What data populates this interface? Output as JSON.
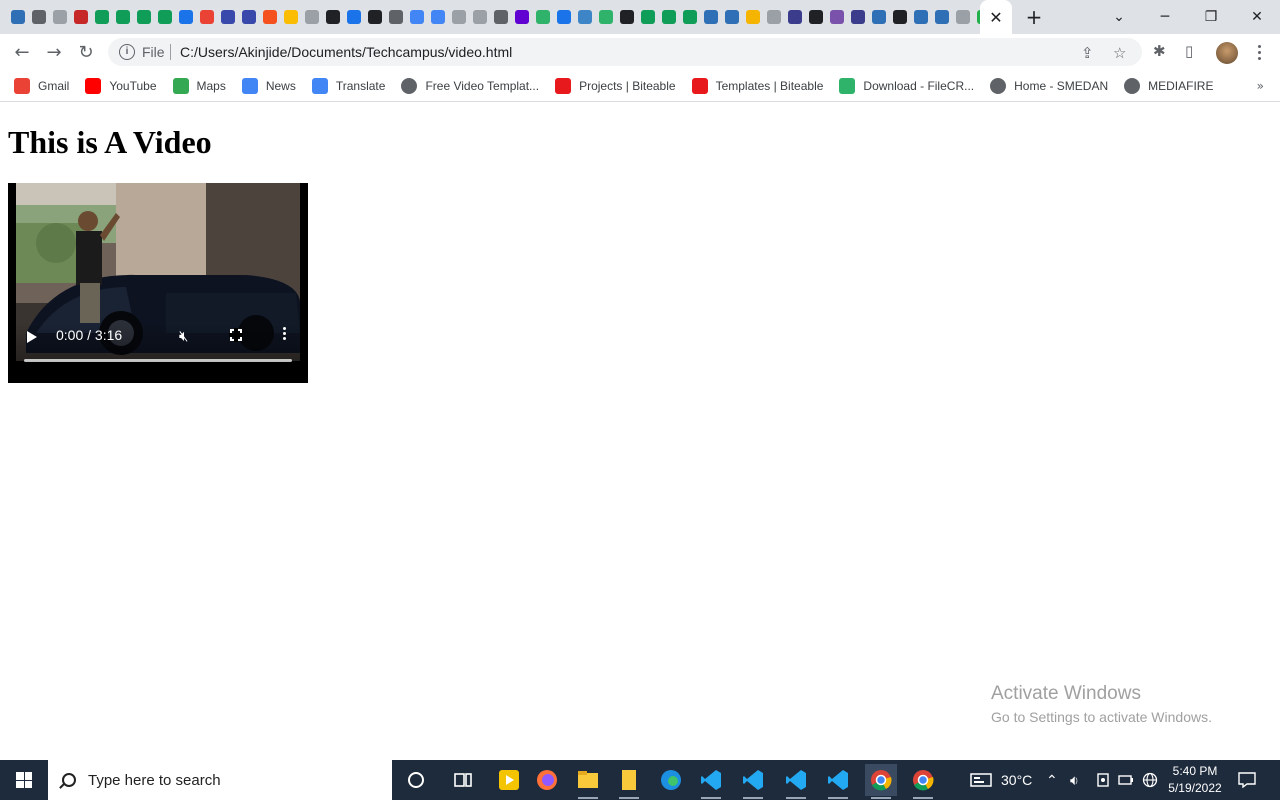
{
  "browser": {
    "url_scheme": "File",
    "url": "C:/Users/Akinjide/Documents/Techcampus/video.html",
    "active_tab_close": "✕",
    "new_tab": "+"
  },
  "bookmarks": [
    {
      "label": "Gmail",
      "icon": "gmail-icon",
      "color": "#ea4335"
    },
    {
      "label": "YouTube",
      "icon": "youtube-icon",
      "color": "#ff0000"
    },
    {
      "label": "Maps",
      "icon": "maps-pin-icon",
      "color": "#34a853"
    },
    {
      "label": "News",
      "icon": "news-icon",
      "color": "#4285f4"
    },
    {
      "label": "Translate",
      "icon": "translate-icon",
      "color": "#4285f4"
    },
    {
      "label": "Free Video Templat...",
      "icon": "globe-icon",
      "color": "#5f6368"
    },
    {
      "label": "Projects | Biteable",
      "icon": "biteable-icon",
      "color": "#e8191c"
    },
    {
      "label": "Templates | Biteable",
      "icon": "biteable-icon",
      "color": "#e8191c"
    },
    {
      "label": "Download - FileCR...",
      "icon": "filecr-icon",
      "color": "#2fb36a"
    },
    {
      "label": "Home - SMEDAN",
      "icon": "globe-icon",
      "color": "#5f6368"
    },
    {
      "label": "MEDIAFIRE",
      "icon": "globe-icon",
      "color": "#5f6368"
    }
  ],
  "page": {
    "heading": "This is A Video",
    "video": {
      "time": "0:00 / 3:16",
      "progress": 0
    }
  },
  "watermark": {
    "line1": "Activate Windows",
    "line2": "Go to Settings to activate Windows."
  },
  "taskbar": {
    "search_placeholder": "Type here to search",
    "temperature": "30°C",
    "time": "5:40 PM",
    "date": "5/19/2022"
  }
}
